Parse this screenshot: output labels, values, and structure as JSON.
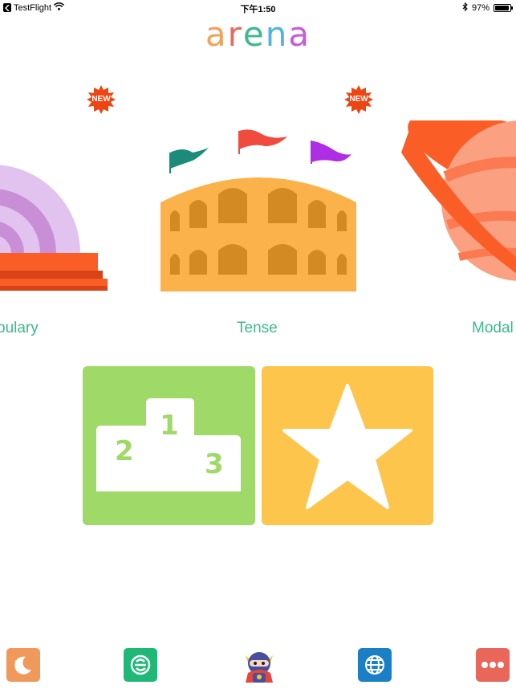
{
  "status_bar": {
    "carrier": "TestFlight",
    "time": "下午1:50",
    "battery_percent_label": "97%",
    "battery_level": 0.97
  },
  "app": {
    "logo_letters": [
      "a",
      "r",
      "e",
      "n",
      "a"
    ],
    "logo_colors": [
      "#f2a05a",
      "#e86a5c",
      "#3cb98e",
      "#4fb3e8",
      "#c75bd8"
    ]
  },
  "carousel": {
    "items": [
      {
        "label": "bulary",
        "badge": "NEW",
        "icon": "rainbow-podium-icon"
      },
      {
        "label": "Tense",
        "badge": "NEW",
        "icon": "colosseum-icon"
      },
      {
        "label": "Modal",
        "badge": "",
        "icon": "planet-icon"
      }
    ]
  },
  "tiles": {
    "leaderboard": {
      "icon": "podium-icon",
      "places": [
        "1",
        "2",
        "3"
      ],
      "color": "#9fd967"
    },
    "favorites": {
      "icon": "star-icon",
      "color": "#fec54c"
    }
  },
  "tab_bar": {
    "tabs": [
      {
        "icon": "moon-icon",
        "color": "#f0995a"
      },
      {
        "icon": "e-logo-icon",
        "color": "#1fb877"
      },
      {
        "icon": "ninja-mascot-icon",
        "color": "#ffffff"
      },
      {
        "icon": "globe-icon",
        "color": "#1a7fc4"
      },
      {
        "icon": "more-dots-icon",
        "color": "#e8675a"
      }
    ]
  }
}
